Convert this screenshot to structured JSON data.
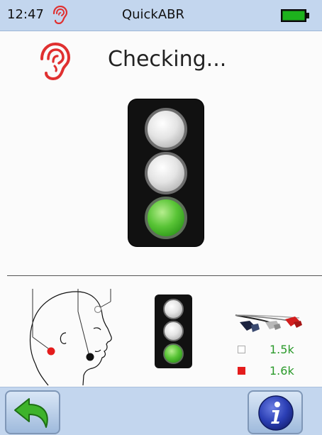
{
  "status_bar": {
    "time": "12:47",
    "app_title": "QuickABR",
    "battery_color": "#1db21d"
  },
  "main": {
    "heading": "Checking...",
    "traffic_light_active": "green",
    "ear_icon_color": "#e03030"
  },
  "electrode_legend": [
    {
      "swatch": "white",
      "value": "1.5k"
    },
    {
      "swatch": "red",
      "value": "1.6k"
    }
  ],
  "toolbar": {
    "back_icon": "green-back-arrow",
    "info_icon": "info-circle"
  },
  "colors": {
    "bar_bg": "#c3d6ee",
    "lamp_on": "#3fb12a",
    "value_text": "#2b9a2b"
  }
}
